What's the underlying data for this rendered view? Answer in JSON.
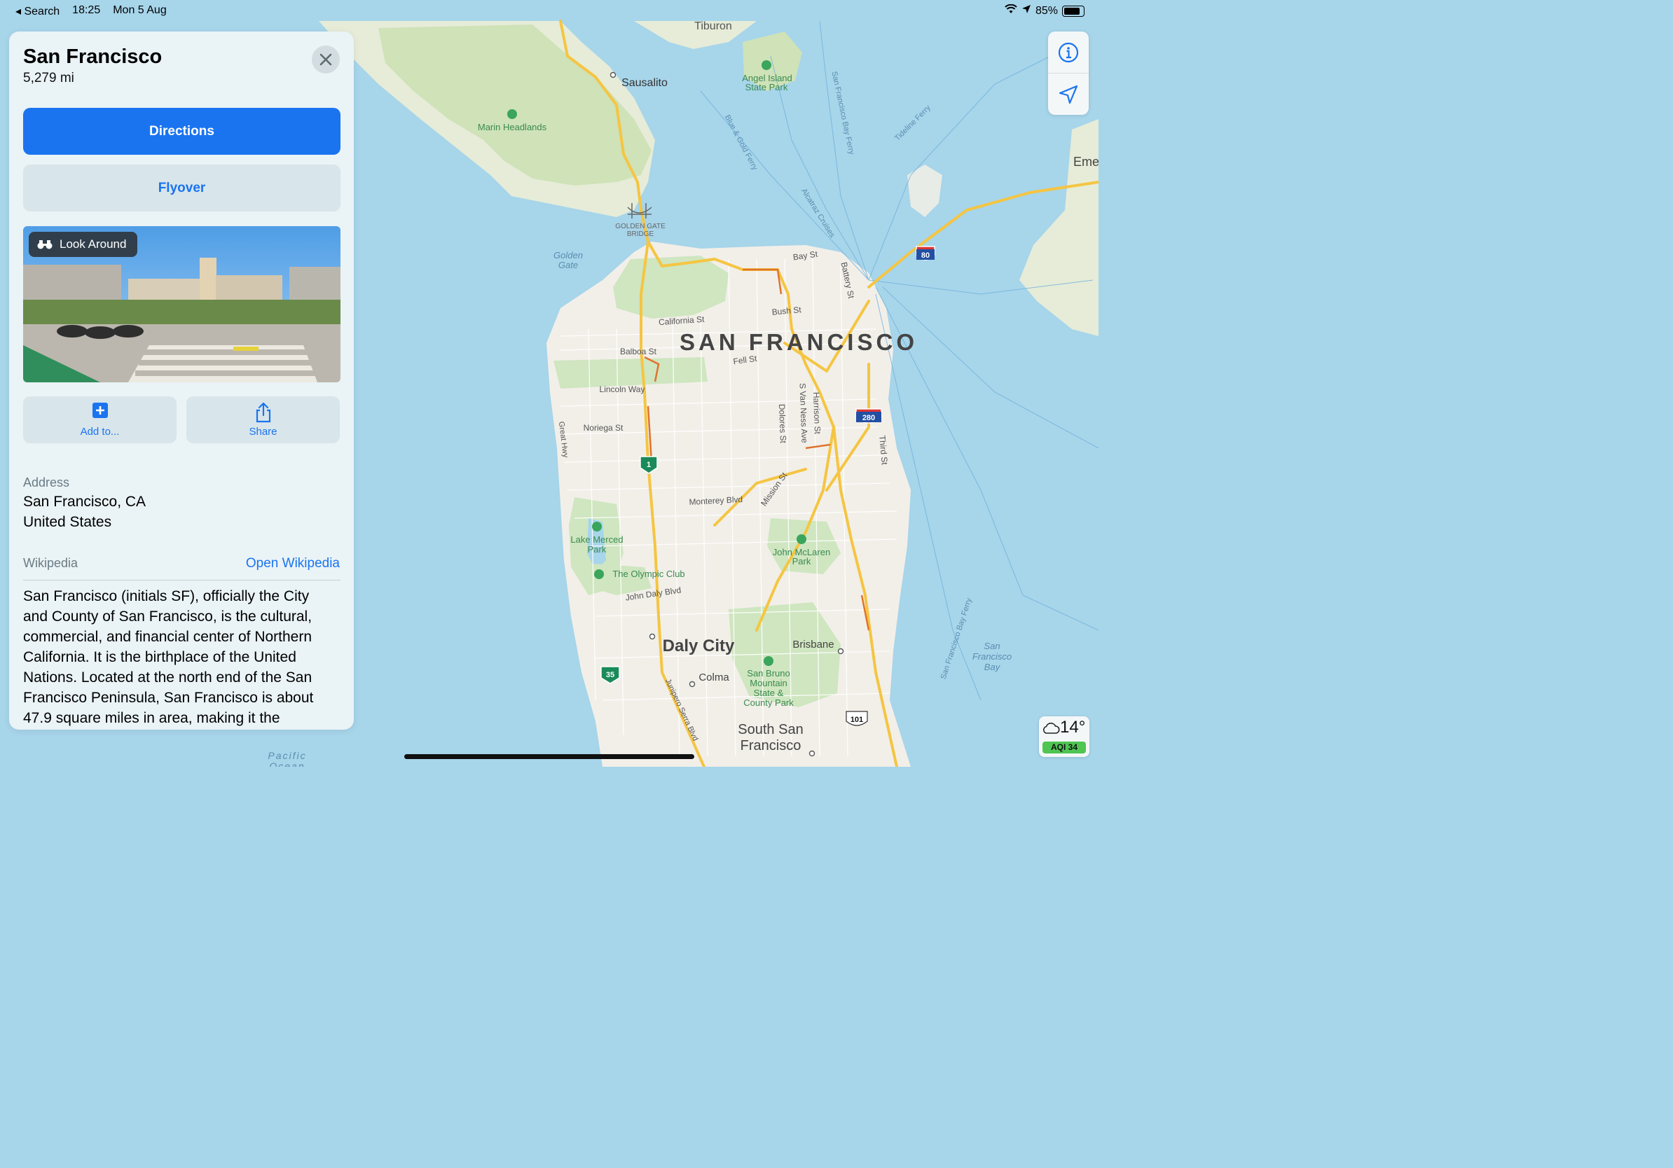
{
  "status_bar": {
    "back_label": "◂ Search",
    "time": "18:25",
    "date": "Mon 5 Aug",
    "battery": "85%"
  },
  "place": {
    "title": "San Francisco",
    "distance": "5,279 mi"
  },
  "buttons": {
    "directions": "Directions",
    "flyover": "Flyover",
    "look_around": "Look Around",
    "add_to": "Add to...",
    "share": "Share"
  },
  "address": {
    "label": "Address",
    "line1": "San Francisco, CA",
    "line2": "United States"
  },
  "wikipedia": {
    "label": "Wikipedia",
    "link": "Open Wikipedia",
    "lines": [
      "San Francisco (initials SF), officially the City",
      "and County of San Francisco, is the cultural,",
      "commercial, and financial center of Northern",
      "California. It is the birthplace of the United",
      "Nations. Located at the north end of the San",
      "Francisco Peninsula, San Francisco is about",
      "47.9 square miles in area, making it the"
    ]
  },
  "weather": {
    "temp": "14°",
    "aqi": "AQI 34"
  },
  "map": {
    "city_label": "SAN FRANCISCO",
    "labels": {
      "tiburon": "Tiburon",
      "sausalito": "Sausalito",
      "angel_island": "Angel Island",
      "state_park": "State Park",
      "marin_headlands": "Marin Headlands",
      "golden_gate_bridge1": "GOLDEN GATE",
      "golden_gate_bridge2": "BRIDGE",
      "golden": "Golden",
      "gate": "Gate",
      "bay_st": "Bay St",
      "bush_st": "Bush St",
      "california_st": "California St",
      "balboa_st": "Balboa St",
      "fell_st": "Fell St",
      "lincoln_way": "Lincoln Way",
      "noriega_st": "Noriega St",
      "great_hwy": "Great Hwy",
      "dolores_st": "Dolores St",
      "van_ness": "S Van Ness Ave",
      "harrison_st": "Harrison St",
      "third_st": "Third St",
      "battery_st": "Battery St",
      "monterey_blvd": "Monterey Blvd",
      "mission_st": "Mission St",
      "lake_merced1": "Lake Merced",
      "lake_merced2": "Park",
      "john_mclaren1": "John McLaren",
      "john_mclaren2": "Park",
      "olympic_club": "The Olympic Club",
      "john_daly": "John Daly Blvd",
      "daly_city": "Daly City",
      "brisbane": "Brisbane",
      "colma": "Colma",
      "san_bruno1": "San Bruno",
      "san_bruno2": "Mountain",
      "san_bruno3": "State &",
      "san_bruno4": "County Park",
      "south_sf1": "South San",
      "south_sf2": "Francisco",
      "sf_bay1": "San",
      "sf_bay2": "Francisco",
      "sf_bay3": "Bay",
      "junipero": "Junipero Serra Blvd",
      "pacific": "Pacific",
      "ocean": "Ocean",
      "emeryville": "Eme",
      "tideline_ferry": "Tideline Ferry",
      "sf_bay_ferry": "San Francisco Bay Ferry",
      "blue_gold_ferry": "Blue & Gold Ferry",
      "alcatraz_cruises": "Alcatraz Cruises",
      "sf_bay_ferry2": "San Francisco Bay Ferry"
    },
    "shields": {
      "i80": "80",
      "i280": "280",
      "ca1": "1",
      "ca35": "35",
      "us101": "101"
    }
  },
  "colors": {
    "accent": "#1a74f0",
    "water": "#a7d5ea",
    "land": "#f2efe9",
    "park": "#cfe6c0",
    "highway": "#f5c542",
    "aqi": "#4fc552"
  }
}
